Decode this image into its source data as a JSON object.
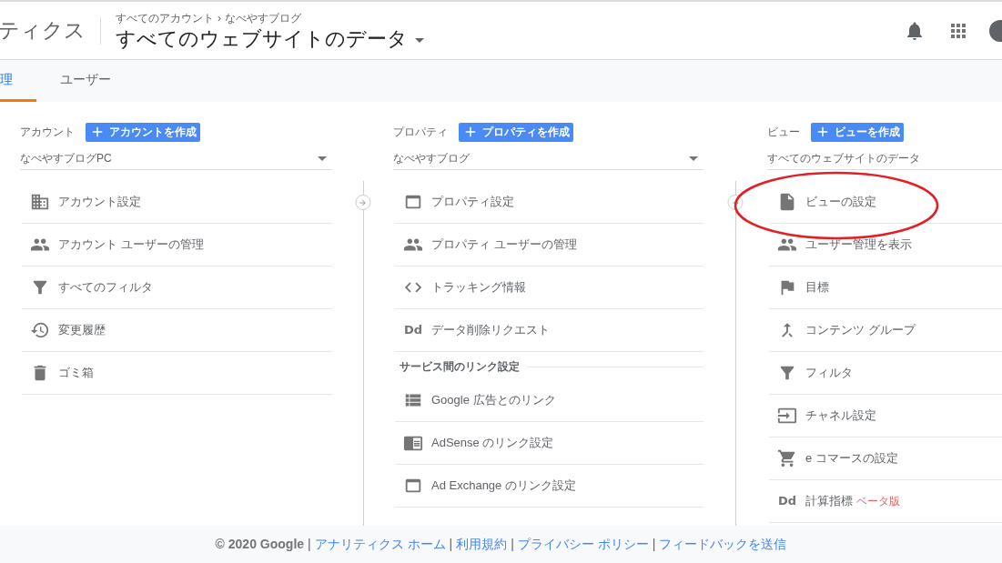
{
  "header": {
    "logo_text": "ティクス",
    "breadcrumb": [
      "すべてのアカウント",
      "›",
      "なべやすブログ"
    ],
    "view_title": "すべてのウェブサイトのデータ"
  },
  "tabs": [
    {
      "label": "理",
      "selected": true
    },
    {
      "label": "ユーザー",
      "selected": false
    }
  ],
  "columns": [
    {
      "label": "アカウント",
      "create_button": "アカウントを作成",
      "selector": "なべやすブログPC",
      "sections": [
        {
          "items": [
            {
              "text": "アカウント設定"
            },
            {
              "text": "アカウント ユーザーの管理"
            },
            {
              "text": "すべてのフィルタ"
            },
            {
              "text": "変更履歴"
            },
            {
              "text": "ゴミ箱"
            }
          ]
        }
      ]
    },
    {
      "label": "プロパティ",
      "create_button": "プロパティを作成",
      "selector": "なべやすブログ",
      "sections": [
        {
          "items": [
            {
              "text": "プロパティ設定"
            },
            {
              "text": "プロパティ ユーザーの管理"
            },
            {
              "text": "トラッキング情報"
            },
            {
              "text": "データ削除リクエスト",
              "icon_text": "Dd"
            }
          ]
        },
        {
          "heading": "サービス間のリンク設定",
          "items": [
            {
              "text": "Google 広告とのリンク"
            },
            {
              "text": "AdSense のリンク設定"
            },
            {
              "text": "Ad Exchange のリンク設定"
            }
          ]
        }
      ]
    },
    {
      "label": "ビュー",
      "create_button": "ビューを作成",
      "selector": "すべてのウェブサイトのデータ",
      "sections": [
        {
          "items": [
            {
              "text": "ビューの設定"
            },
            {
              "text": "ユーザー管理を表示"
            },
            {
              "text": "目標"
            },
            {
              "text": "コンテンツ グループ"
            },
            {
              "text": "フィルタ"
            },
            {
              "text": "チャネル設定"
            },
            {
              "text": "e コマースの設定"
            },
            {
              "text": "計算指標",
              "icon_text": "Dd",
              "badge": "ベータ版"
            }
          ]
        }
      ]
    }
  ],
  "footer": [
    {
      "kind": "text",
      "text": "© 2020 Google"
    },
    {
      "kind": "separator",
      "text": "|"
    },
    {
      "kind": "link",
      "text": "アナリティクス ホーム"
    },
    {
      "kind": "separator",
      "text": "|"
    },
    {
      "kind": "link",
      "text": "利用規約"
    },
    {
      "kind": "separator",
      "text": "|"
    },
    {
      "kind": "link",
      "text": "プライバシー ポリシー"
    },
    {
      "kind": "separator",
      "text": "|"
    },
    {
      "kind": "link",
      "text": "フィードバックを送信"
    }
  ]
}
